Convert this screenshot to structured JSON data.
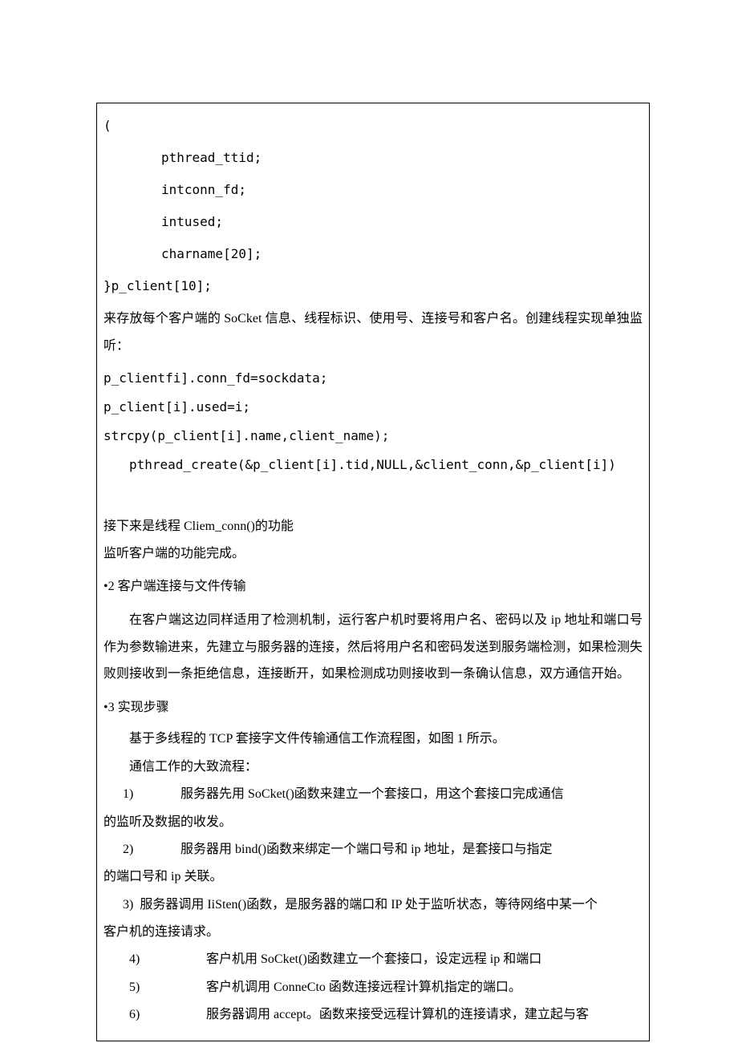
{
  "code": {
    "brace_open": "(",
    "l1": "pthread_ttid;",
    "l2": "intconn_fd;",
    "l3": "intused;",
    "l4": "charname[20];",
    "brace_close": "}p_client[10];",
    "desc1": "来存放每个客户端的 SoCket 信息、线程标识、使用号、连接号和客户名。创建线程实现单独监听：",
    "c1": "p_clientfi].conn_fd=sockdata;",
    "c2": "p_client[i].used=i;",
    "c3": "strcpy(p_client[i].name,client_name);",
    "c4": "pthread_create(&p_client[i].tid,NULL,&client_conn,&p_client[i])"
  },
  "sec1": {
    "p1": "接下来是线程 Cliem_conn()的功能",
    "p2": "监听客户端的功能完成。"
  },
  "sec2": {
    "title": "•2 客户端连接与文件传输",
    "body": "在客户端这边同样适用了检测机制，运行客户机时要将用户名、密码以及 ip 地址和端口号作为参数输进来，先建立与服务器的连接，然后将用户名和密码发送到服务端检测，如果检测失败则接收到一条拒绝信息，连接断开，如果检测成功则接收到一条确认信息，双方通信开始。"
  },
  "sec3": {
    "title": "•3 实现步骤",
    "p1": "基于多线程的 TCP 套接字文件传输通信工作流程图，如图 1 所示。",
    "p2": "通信工作的大致流程：",
    "items": [
      {
        "n": "1)",
        "t": "服务器先用 SoCket()函数来建立一个套接口，用这个套接口完成通信"
      },
      {
        "cont": "的监听及数据的收发。"
      },
      {
        "n": "2)",
        "t": "服务器用 bind()函数来绑定一个端口号和 ip 地址，是套接口与指定"
      },
      {
        "cont": "的端口号和 ip 关联。"
      },
      {
        "n2": "3)",
        "t": "服务器调用 IiSten()函数，是服务器的端口和 IP 处于监听状态，等待网络中某一个"
      },
      {
        "cont2": "客户机的连接请求。"
      },
      {
        "n": "4)",
        "t": "客户机用 SoCket()函数建立一个套接口，设定远程 ip 和端口"
      },
      {
        "n": "5)",
        "t": "客户机调用 ConneCto 函数连接远程计算机指定的端口。"
      },
      {
        "n": "6)",
        "t": "服务器调用 accept。函数来接受远程计算机的连接请求，建立起与客"
      }
    ]
  }
}
